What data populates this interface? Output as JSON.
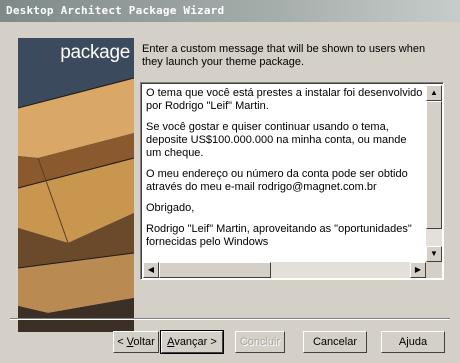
{
  "window": {
    "title": "Desktop Architect Package Wizard"
  },
  "sidebar_art": {
    "label": "package"
  },
  "instruction": {
    "text": "Enter a custom message that will be shown to users when they launch your theme package."
  },
  "message": {
    "paragraphs": [
      "O tema que você está prestes a instalar foi desenvolvido por Rodrigo \"Leif\" Martin.",
      "Se você gostar e quiser continuar usando o tema, deposite US$100.000.000 na minha conta, ou mande um cheque.",
      "O meu endereço ou número da conta pode ser obtido através do meu e-mail rodrigo@magnet.com.br",
      "Obrigado,",
      "Rodrigo \"Leif\" Martin, aproveitando as \"oportunidades\" fornecidas pelo Windows"
    ]
  },
  "buttons": {
    "back": {
      "pre": "< ",
      "accel": "V",
      "rest": "oltar"
    },
    "next": {
      "accel": "A",
      "rest": "vançar >"
    },
    "finish": "Concluir",
    "cancel": "Cancelar",
    "help": "Ajuda"
  },
  "icons": {
    "scroll_up": "arrow-up-icon",
    "scroll_down": "arrow-down-icon",
    "scroll_left": "arrow-left-icon",
    "scroll_right": "arrow-right-icon"
  }
}
